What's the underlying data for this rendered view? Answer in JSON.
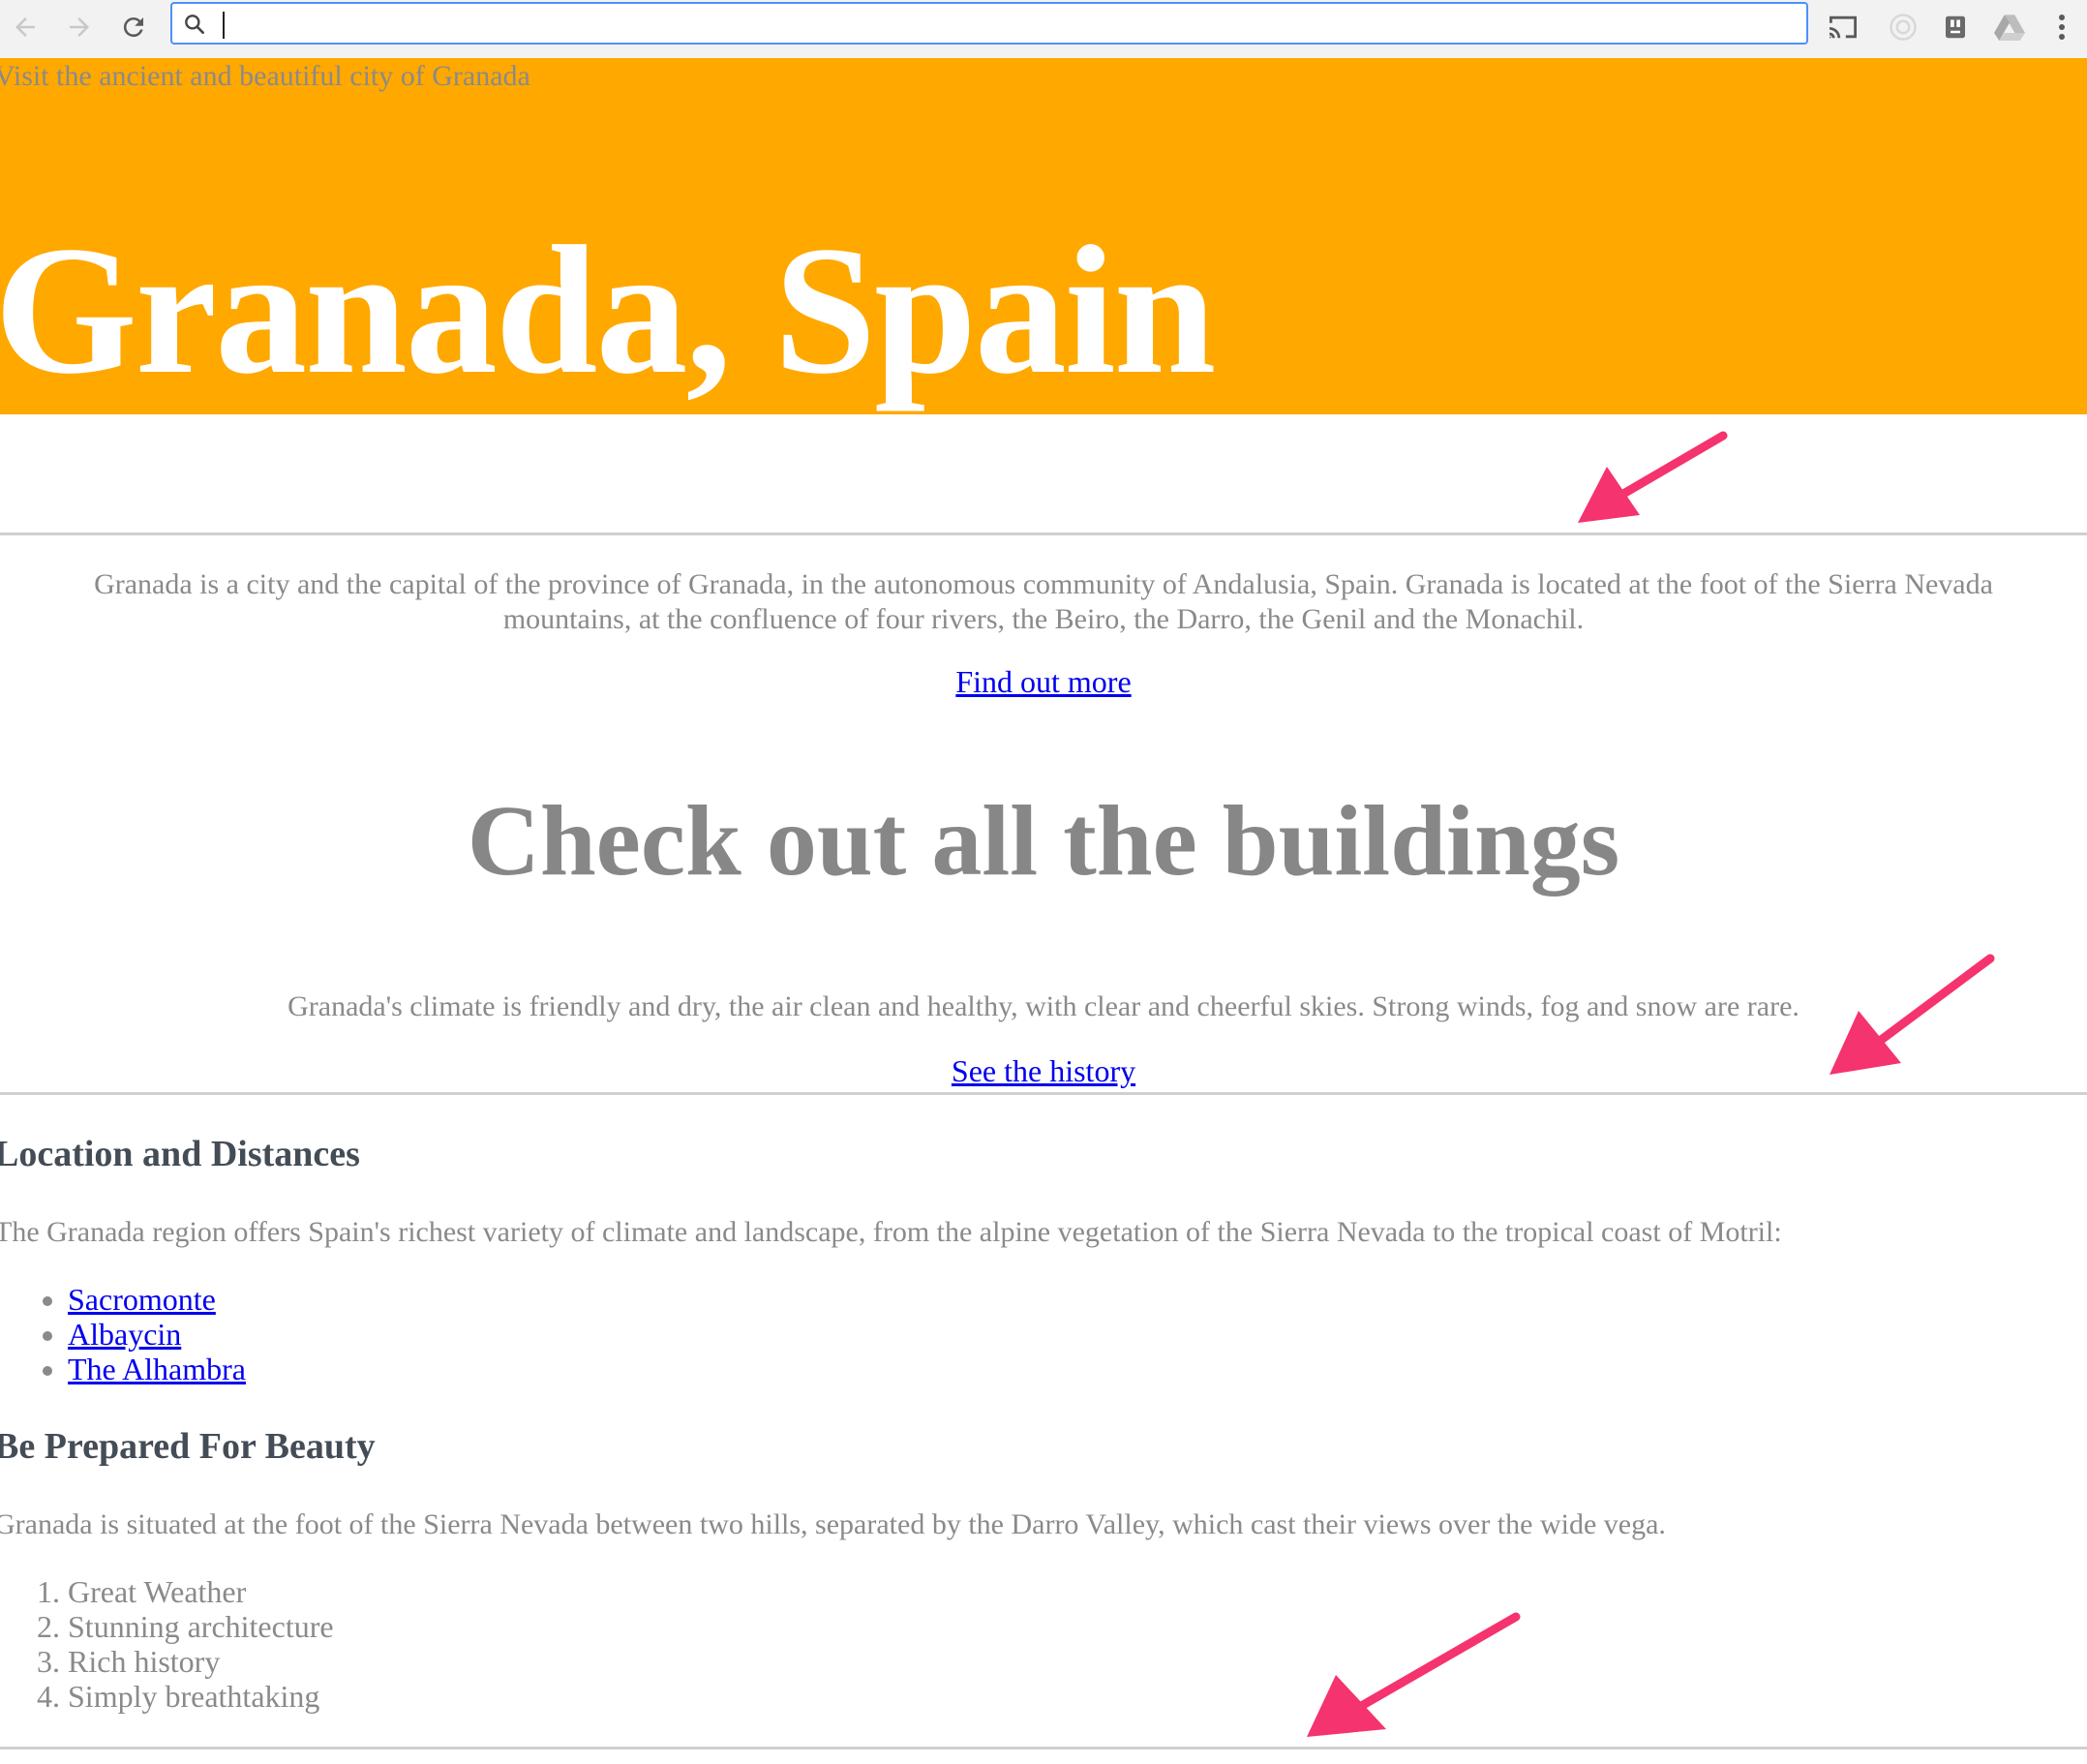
{
  "browser": {
    "omnibox_value": "",
    "icons": {
      "back": "back-arrow-icon",
      "forward": "forward-arrow-icon",
      "reload": "reload-icon",
      "search": "search-icon",
      "cast": "cast-icon",
      "extension_1": "circle-extension-icon",
      "extension_2": "book-extension-icon",
      "extension_3": "drive-icon",
      "menu": "kebab-menu-icon"
    }
  },
  "hero": {
    "tagline": "Visit the ancient and beautiful city of Granada",
    "title": "Granada, Spain",
    "background_color": "#ffa800"
  },
  "intro": {
    "text": "Granada is a city and the capital of the province of Granada, in the autonomous community of Andalusia, Spain. Granada is located at the foot of the Sierra Nevada mountains, at the confluence of four rivers, the Beiro, the Darro, the Genil and the Monachil.",
    "link": "Find out more"
  },
  "buildings": {
    "title": "Check out all the buildings",
    "text": "Granada's climate is friendly and dry, the air clean and healthy, with clear and cheerful skies. Strong winds, fog and snow are rare.",
    "link": "See the history"
  },
  "location": {
    "heading": "Location and Distances",
    "text": "The Granada region offers Spain's richest variety of climate and landscape, from the alpine vegetation of the Sierra Nevada to the tropical coast of Motril:",
    "places": [
      "Sacromonte",
      "Albaycin",
      "The Alhambra"
    ]
  },
  "beauty": {
    "heading": "Be Prepared For Beauty",
    "text": "Granada is situated at the foot of the Sierra Nevada between two hills, separated by the Darro Valley, which cast their views over the wide vega.",
    "reasons": [
      "Great Weather",
      "Stunning architecture",
      "Rich history",
      "Simply breathtaking"
    ]
  },
  "colors": {
    "link": "#0000ee",
    "body_text": "#8a8a8a",
    "heading_text": "#444c56",
    "annotation_arrow": "#f5336e"
  }
}
